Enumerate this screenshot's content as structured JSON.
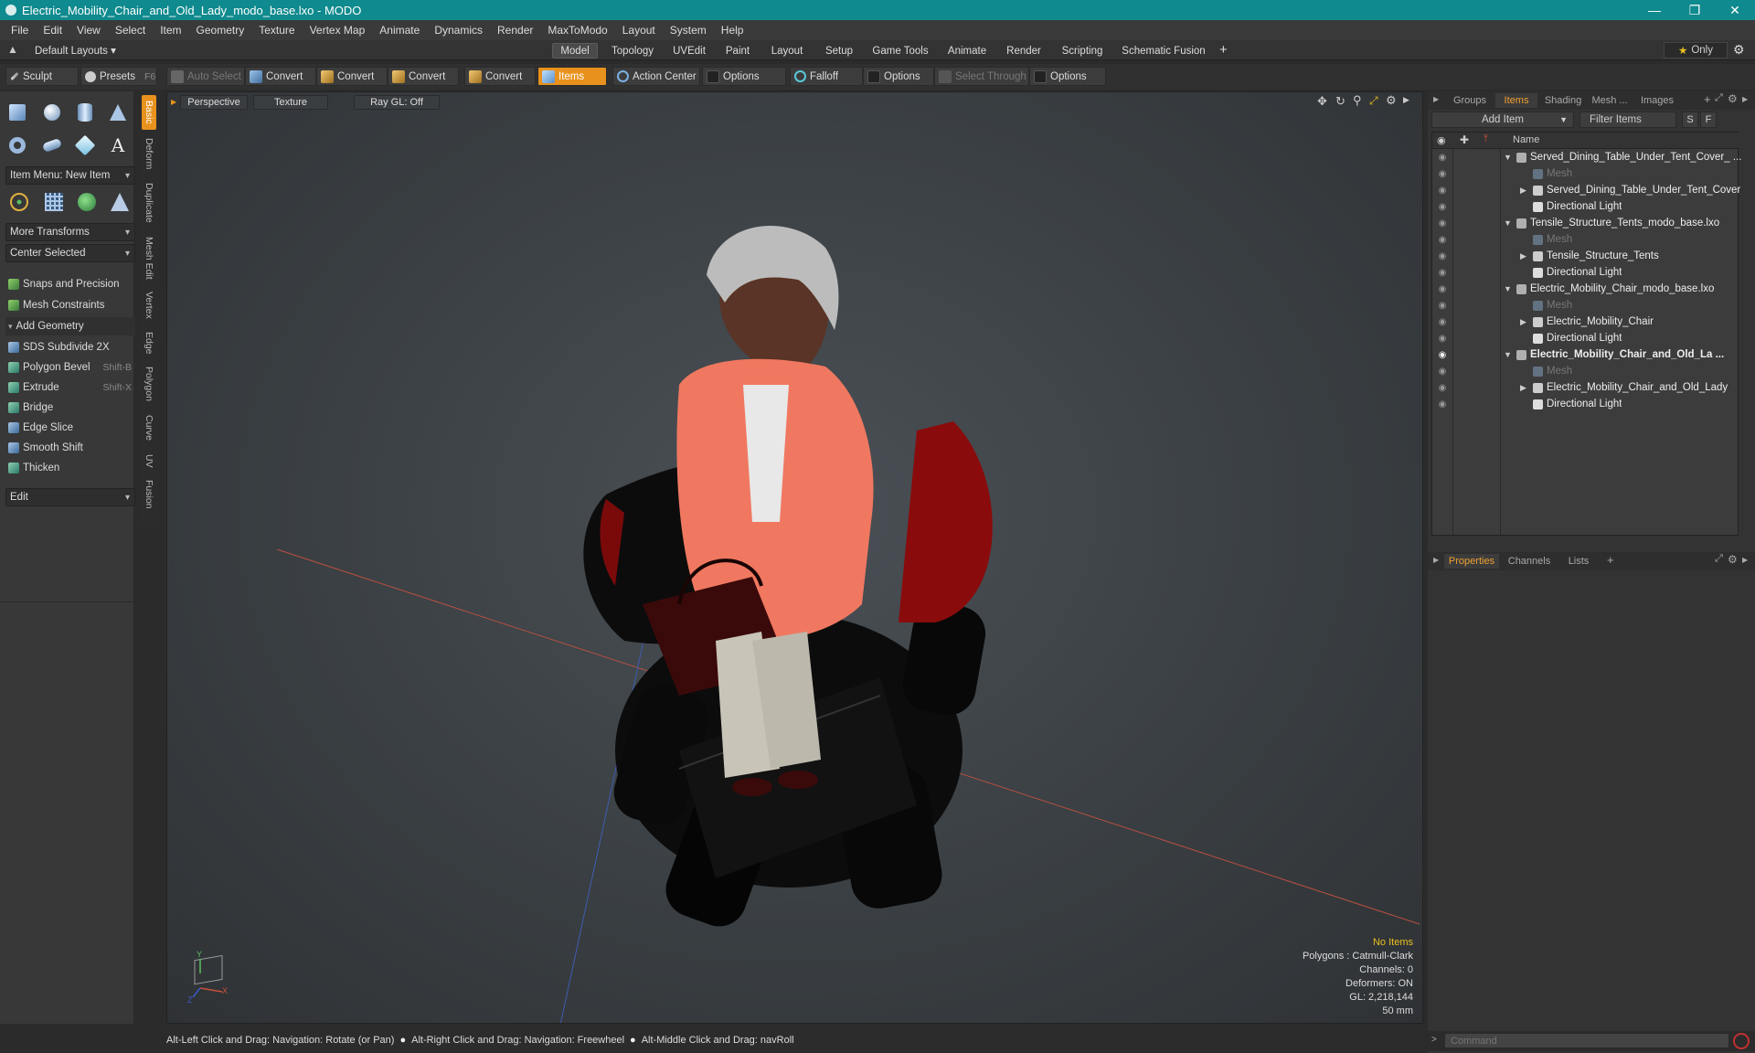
{
  "window": {
    "title": "Electric_Mobility_Chair_and_Old_Lady_modo_base.lxo - MODO"
  },
  "menu": [
    "File",
    "Edit",
    "View",
    "Select",
    "Item",
    "Geometry",
    "Texture",
    "Vertex Map",
    "Animate",
    "Dynamics",
    "Render",
    "MaxToModo",
    "Layout",
    "System",
    "Help"
  ],
  "layout": {
    "default_layouts": "Default Layouts",
    "tabs": [
      "Model",
      "Topology",
      "UVEdit",
      "Paint",
      "Layout",
      "Setup",
      "Game Tools",
      "Animate",
      "Render",
      "Scripting",
      "Schematic Fusion"
    ],
    "active_tab": "Model",
    "only_label": "Only"
  },
  "toolbar": {
    "sculpt": "Sculpt",
    "presets": "Presets",
    "presets_shortcut": "F6",
    "auto_select": "Auto Select",
    "convert1": "Convert",
    "convert2": "Convert",
    "convert3": "Convert",
    "convert4": "Convert",
    "items": "Items",
    "action_center": "Action Center",
    "options1": "Options",
    "falloff": "Falloff",
    "options2": "Options",
    "select_through": "Select Through",
    "options3": "Options"
  },
  "left": {
    "item_menu": "Item Menu: New Item",
    "more_transforms": "More Transforms",
    "center_selected": "Center Selected",
    "snaps": "Snaps and Precision",
    "mesh_constraints": "Mesh Constraints",
    "add_geometry": "Add Geometry",
    "tools": [
      {
        "label": "SDS Subdivide 2X",
        "shortcut": ""
      },
      {
        "label": "Polygon Bevel",
        "shortcut": "Shift-B"
      },
      {
        "label": "Extrude",
        "shortcut": "Shift-X"
      },
      {
        "label": "Bridge",
        "shortcut": ""
      },
      {
        "label": "Edge Slice",
        "shortcut": ""
      },
      {
        "label": "Smooth Shift",
        "shortcut": ""
      },
      {
        "label": "Thicken",
        "shortcut": ""
      }
    ],
    "edit": "Edit",
    "vtabs": [
      "Basic",
      "Deform",
      "Duplicate",
      "Mesh Edit",
      "Vertex",
      "Edge",
      "Polygon",
      "Curve",
      "UV",
      "Fusion"
    ]
  },
  "viewport": {
    "perspective": "Perspective",
    "texture": "Texture",
    "raygl": "Ray GL: Off",
    "stats": {
      "no_items": "No Items",
      "polygons": "Polygons : Catmull-Clark",
      "channels": "Channels: 0",
      "deformers": "Deformers: ON",
      "gl": "GL: 2,218,144",
      "focal": "50 mm"
    }
  },
  "status": {
    "hint1": "Alt-Left Click and Drag: Navigation: Rotate (or Pan)",
    "hint2": "Alt-Right Click and Drag: Navigation: Freewheel",
    "hint3": "Alt-Middle Click and Drag: navRoll"
  },
  "right": {
    "tabs": [
      "Groups",
      "Items",
      "Shading",
      "Mesh ...",
      "Images"
    ],
    "active_tab": "Items",
    "add_item": "Add Item",
    "filter_items": "Filter Items",
    "s_btn": "S",
    "f_btn": "F",
    "name_col": "Name",
    "items": [
      {
        "label": "Served_Dining_Table_Under_Tent_Cover_ ...",
        "level": 0,
        "type": "scene",
        "bold": false
      },
      {
        "label": "Mesh",
        "level": 1,
        "type": "mesh",
        "dim": true
      },
      {
        "label": "Served_Dining_Table_Under_Tent_Cover",
        "level": 1,
        "type": "group",
        "expandable": true
      },
      {
        "label": "Directional Light",
        "level": 1,
        "type": "light"
      },
      {
        "label": "Tensile_Structure_Tents_modo_base.lxo",
        "level": 0,
        "type": "scene"
      },
      {
        "label": "Mesh",
        "level": 1,
        "type": "mesh",
        "dim": true
      },
      {
        "label": "Tensile_Structure_Tents",
        "level": 1,
        "type": "group",
        "expandable": true
      },
      {
        "label": "Directional Light",
        "level": 1,
        "type": "light"
      },
      {
        "label": "Electric_Mobility_Chair_modo_base.lxo",
        "level": 0,
        "type": "scene"
      },
      {
        "label": "Mesh",
        "level": 1,
        "type": "mesh",
        "dim": true
      },
      {
        "label": "Electric_Mobility_Chair",
        "level": 1,
        "type": "group",
        "expandable": true
      },
      {
        "label": "Directional Light",
        "level": 1,
        "type": "light"
      },
      {
        "label": "Electric_Mobility_Chair_and_Old_La ...",
        "level": 0,
        "type": "scene",
        "bold": true
      },
      {
        "label": "Mesh",
        "level": 1,
        "type": "mesh",
        "dim": true
      },
      {
        "label": "Electric_Mobility_Chair_and_Old_Lady",
        "level": 1,
        "type": "group",
        "expandable": true
      },
      {
        "label": "Directional Light",
        "level": 1,
        "type": "light"
      }
    ],
    "bottom_tabs": [
      "Properties",
      "Channels",
      "Lists"
    ],
    "bottom_active": "Properties",
    "command_placeholder": "Command"
  },
  "colors": {
    "accent": "#e8921d",
    "titlebar": "#0f8a8e",
    "axis_x": "#c8503c",
    "axis_z": "#3c5ac8"
  }
}
